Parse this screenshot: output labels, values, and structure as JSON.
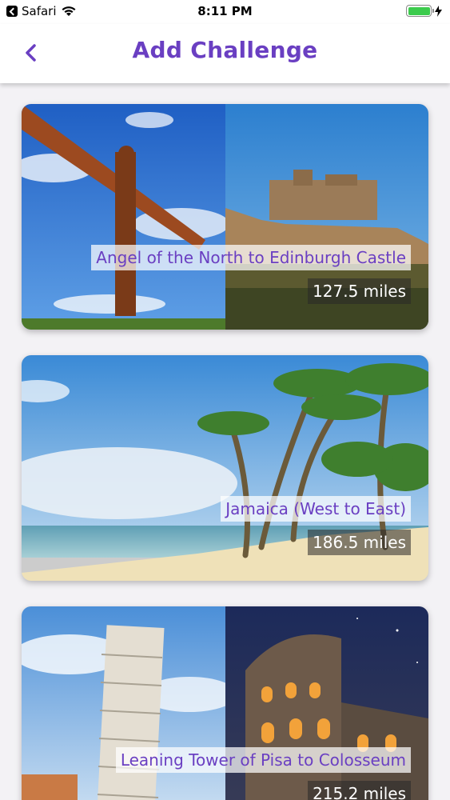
{
  "status_bar": {
    "back_app_label": "Safari",
    "time": "8:11 PM"
  },
  "header": {
    "title": "Add Challenge"
  },
  "challenges": [
    {
      "name": "Angel of the North to Edinburgh Castle",
      "distance": "127.5 miles"
    },
    {
      "name": "Jamaica (West to East)",
      "distance": "186.5 miles"
    },
    {
      "name": "Leaning Tower of Pisa to Colosseum",
      "distance": "215.2 miles"
    }
  ],
  "colors": {
    "accent": "#6a3fc2",
    "battery": "#3ccb4d"
  }
}
